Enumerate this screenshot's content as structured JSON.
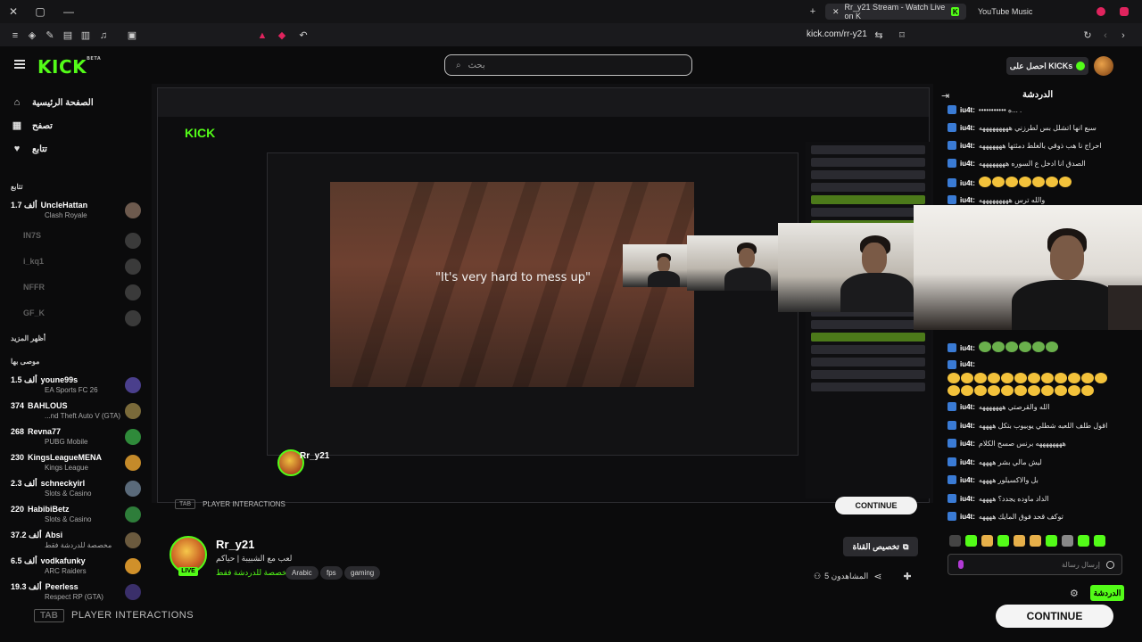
{
  "browser": {
    "tabs": [
      {
        "label": "Rr_y21 Stream - Watch Live on K",
        "active": true
      },
      {
        "label": "YouTube Music",
        "active": false
      }
    ],
    "url": "kick.com/rr-y21"
  },
  "header": {
    "logo": "KICK",
    "logo_sup": "BETA",
    "search_placeholder": "بحث",
    "get_kicks": "احصل على KICKs"
  },
  "sidebar": {
    "nav": [
      {
        "label": "الصفحة الرئيسية",
        "icon": "home-icon"
      },
      {
        "label": "تصفح",
        "icon": "browse-icon"
      },
      {
        "label": "تتابع",
        "icon": "heart-icon"
      }
    ],
    "following_label": "تتابع",
    "following": [
      {
        "count": "1.7 ألف",
        "name": "UncleHattan",
        "category": "Clash Royale",
        "online": true
      },
      {
        "name": "IN7S",
        "online": false
      },
      {
        "name": "i_kq1",
        "online": false
      },
      {
        "name": "NFFR",
        "online": false
      },
      {
        "name": "GF_K",
        "online": false
      }
    ],
    "show_more": "أظهر المزيد",
    "recommended_label": "موصى بها",
    "recommended": [
      {
        "count": "1.5 ألف",
        "name": "youne99s",
        "category": "EA Sports FC 26"
      },
      {
        "count": "374",
        "name": "BAHLOUS",
        "category": "...nd Theft Auto V (GTA)"
      },
      {
        "count": "268",
        "name": "Revna77",
        "category": "PUBG Mobile"
      },
      {
        "count": "230",
        "name": "KingsLeagueMENA",
        "category": "Kings League"
      },
      {
        "count": "2.3 ألف",
        "name": "schneckyirl",
        "category": "Slots & Casino"
      },
      {
        "count": "220",
        "name": "HabibiBetz",
        "category": "Slots & Casino"
      },
      {
        "count": "37.2 ألف",
        "name": "Absi",
        "category": "مخصصة للدردشة فقط"
      },
      {
        "count": "6.5 ألف",
        "name": "vodkafunky",
        "category": "ARC Raiders"
      },
      {
        "count": "19.3 ألف",
        "name": "Peerless",
        "category": "Respect RP (GTA)"
      }
    ]
  },
  "player": {
    "caption": "\"It's very hard to mess up\"",
    "tab_key": "TAB",
    "player_interactions": "PLAYER INTERACTIONS",
    "continue": "CONTINUE"
  },
  "stream": {
    "streamer": "Rr_y21",
    "live": "LIVE",
    "title": "لعب مع الشبيبة | حياكم",
    "category": "مخصصة للدردشة فقط",
    "tags": [
      "Arabic",
      "fps",
      "gaming"
    ],
    "customize": "تخصيص القناة",
    "viewers": "5 المشاهدون"
  },
  "chat": {
    "title": "الدردشة",
    "messages": [
      {
        "user": "iu4t:",
        "text": "••••••••••• ه... ."
      },
      {
        "user": "iu4t:",
        "text": "سبع انها اتشلل بس لطرزني هههههههههه"
      },
      {
        "user": "iu4t:",
        "text": "احراج نا هب ذوقي بالغلط دمثتها هههههههه"
      },
      {
        "user": "iu4t:",
        "text": "الصدق انا ادخل ع السوره ههههههههه"
      },
      {
        "user": "iu4t:",
        "text": ""
      },
      {
        "user": "iu4t:",
        "text": "والله ترس هههههههههه"
      },
      {
        "user": "iu4t:",
        "text": ""
      },
      {
        "user": "iu4t:",
        "text": ""
      },
      {
        "user": "iu4t:",
        "text": "الله والقرصتي هههههههه"
      },
      {
        "user": "iu4t:",
        "text": "اقول طلف اللعبه شطلي يوبيوب بتكل ههههه"
      },
      {
        "user": "iu4t:",
        "text": "ههههههههه برنس صسح الكلام"
      },
      {
        "user": "iu4t:",
        "text": "ليش مالي بشر ههههه"
      },
      {
        "user": "iu4t:",
        "text": "بل والاكسيلور ههههه"
      },
      {
        "user": "iu4t:",
        "text": "الداد ماوده يجدد؟ ههههه"
      },
      {
        "user": "iu4t:",
        "text": "توكف قحد فوق المايك ههههه"
      }
    ],
    "input_placeholder": "إرسال رسالة",
    "send": "الدردشة"
  }
}
